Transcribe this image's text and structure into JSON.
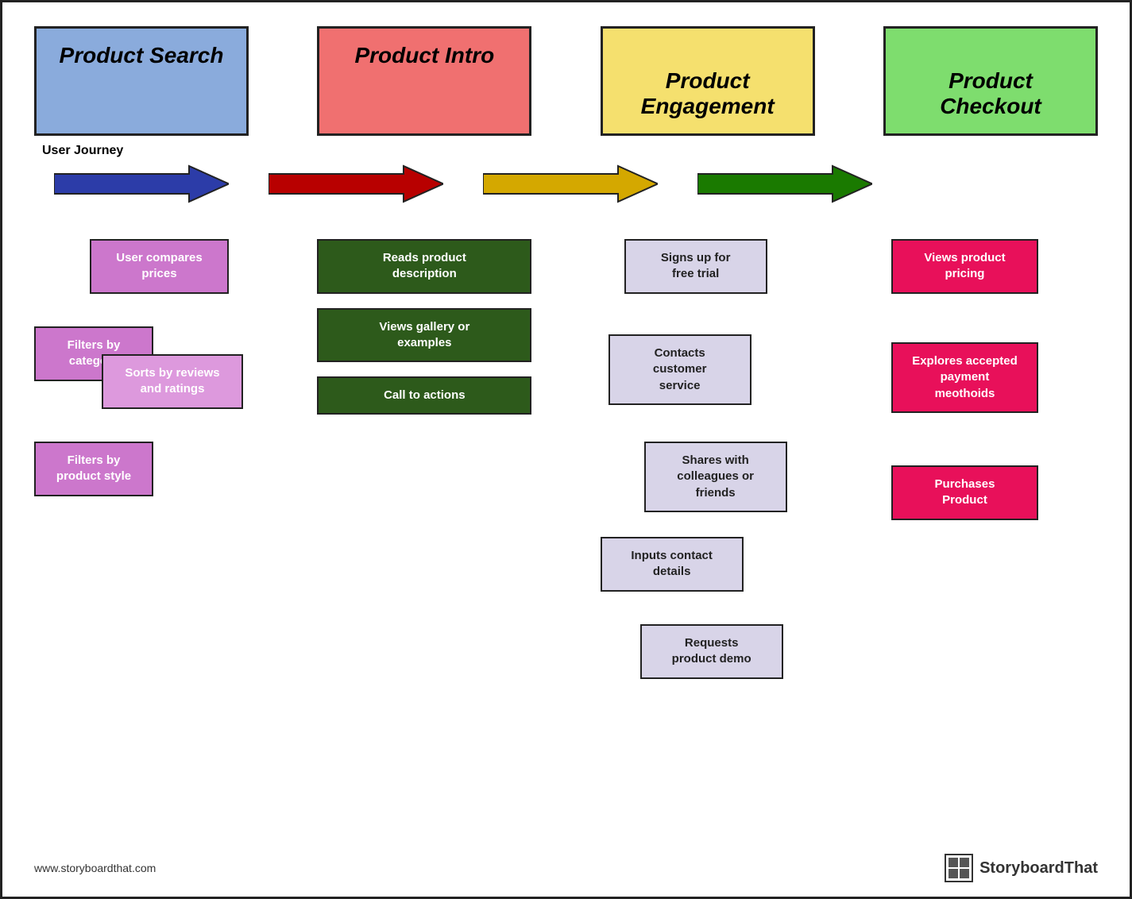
{
  "headers": {
    "search": "Product Search",
    "intro": "Product Intro",
    "engagement": "Product\nEngagement",
    "checkout": "Product\nCheckout"
  },
  "journey_label": "User Journey",
  "cards": {
    "search": {
      "user_compares": "User compares\nprices",
      "filters_cat": "Filters by\ncategory",
      "sorts": "Sorts by reviews\nand ratings",
      "filters_style": "Filters by\nproduct style"
    },
    "intro": {
      "reads": "Reads product\ndescription",
      "views_gallery": "Views gallery or\nexamples",
      "call_to": "Call to actions"
    },
    "engagement": {
      "signs_up": "Signs up for\nfree trial",
      "contacts": "Contacts\ncustomer\nservice",
      "shares": "Shares with\ncolleagues or\nfriends",
      "inputs": "Inputs contact\ndetails",
      "requests": "Requests\nproduct demo"
    },
    "checkout": {
      "views_pricing": "Views product\npricing",
      "explores": "Explores accepted\npayment\nmeothoids",
      "purchases": "Purchases\nProduct"
    }
  },
  "footer": {
    "url": "www.storyboardthat.com",
    "brand": "StoryboardThat"
  }
}
